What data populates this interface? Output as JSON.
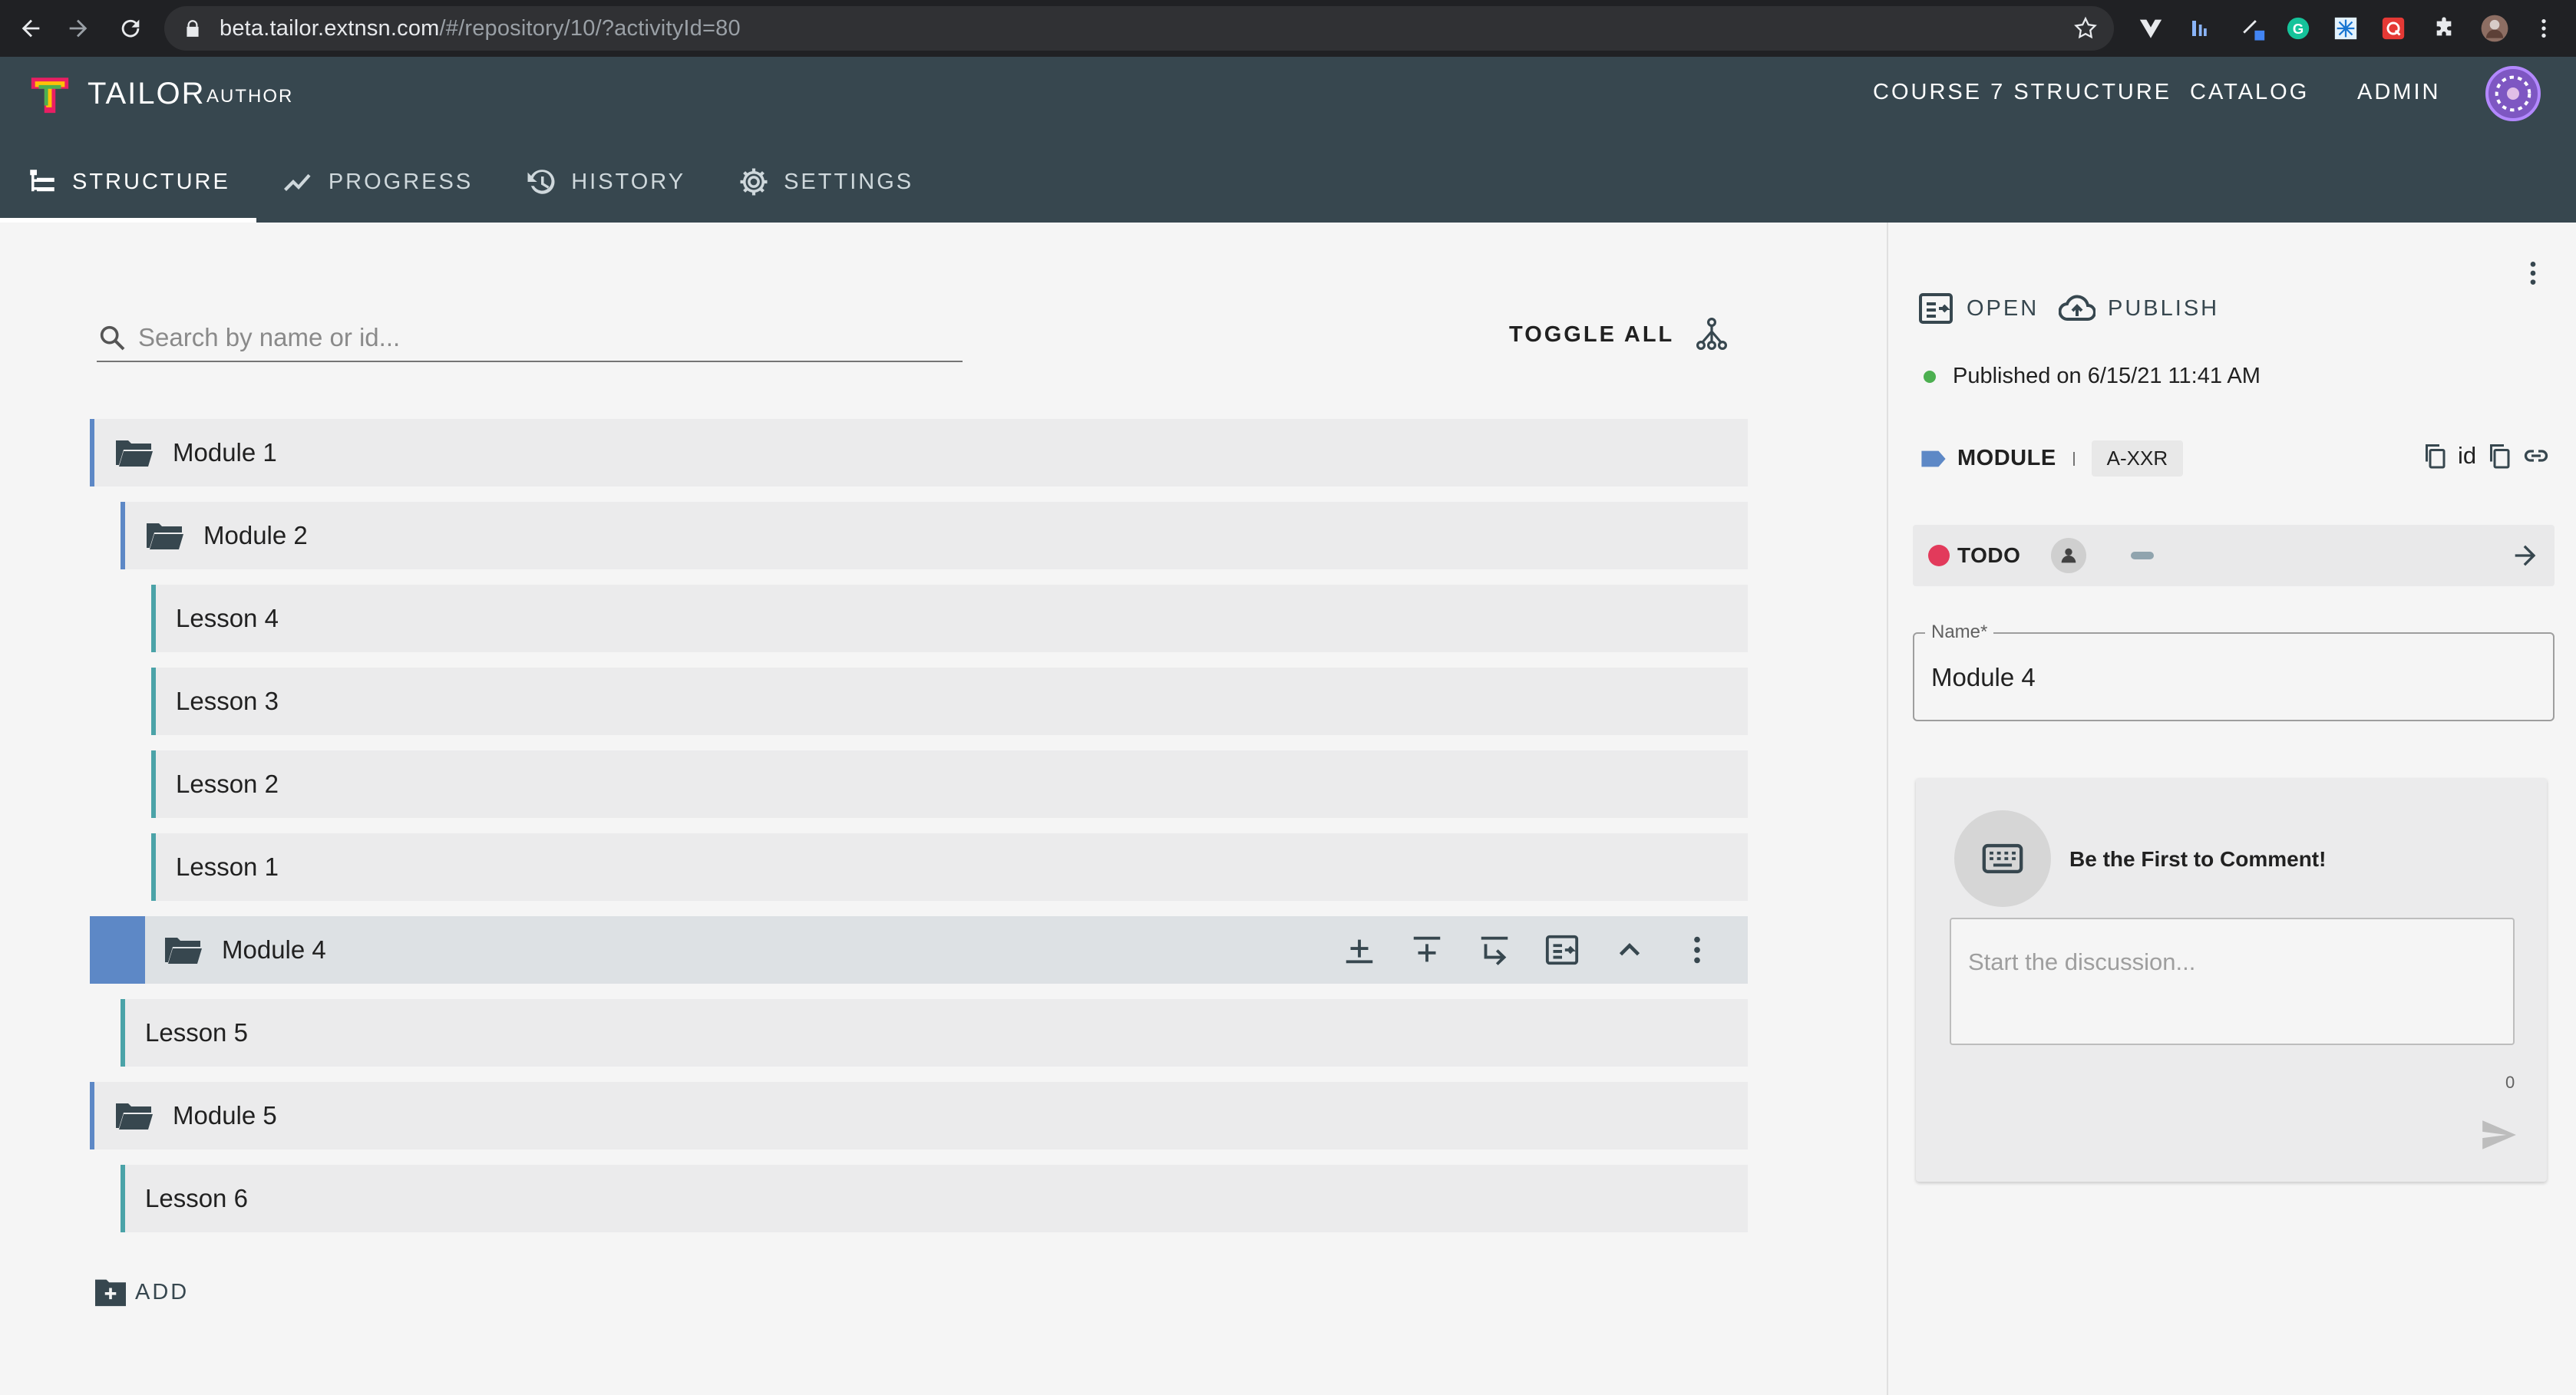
{
  "browser": {
    "url_host": "beta.tailor.extnsn.com",
    "url_path": "/#/repository/10/?activityId=80"
  },
  "app": {
    "brand": "TAILOR",
    "brand_sub": "AUTHOR",
    "top_nav": [
      "COURSE 7 STRUCTURE",
      "CATALOG",
      "ADMIN"
    ],
    "tabs": [
      {
        "label": "STRUCTURE",
        "icon": "structure-icon",
        "active": true
      },
      {
        "label": "PROGRESS",
        "icon": "trending-up-icon",
        "active": false
      },
      {
        "label": "HISTORY",
        "icon": "history-icon",
        "active": false
      },
      {
        "label": "SETTINGS",
        "icon": "gear-icon",
        "active": false
      }
    ]
  },
  "structure": {
    "search_placeholder": "Search by name or id...",
    "toggle_all": "TOGGLE ALL",
    "add_label": "ADD",
    "items": [
      {
        "label": "Module 1",
        "type": "module"
      },
      {
        "label": "Module 2",
        "type": "module"
      },
      {
        "label": "Lesson 4",
        "type": "lesson"
      },
      {
        "label": "Lesson 3",
        "type": "lesson"
      },
      {
        "label": "Lesson 2",
        "type": "lesson"
      },
      {
        "label": "Lesson 1",
        "type": "lesson"
      },
      {
        "label": "Module 4",
        "type": "module",
        "selected": true
      },
      {
        "label": "Lesson 5",
        "type": "lesson"
      },
      {
        "label": "Module 5",
        "type": "module"
      },
      {
        "label": "Lesson 6",
        "type": "lesson"
      }
    ]
  },
  "sidebar": {
    "open_label": "OPEN",
    "publish_label": "PUBLISH",
    "published_text": "Published on 6/15/21 11:41 AM",
    "type_label": "MODULE",
    "short_id": "A-XXR",
    "id_label": "id",
    "workflow_status": "TODO",
    "name_field_label": "Name*",
    "name_field_value": "Module 4",
    "comments_empty": "Be the First to Comment!",
    "comment_placeholder": "Start the discussion...",
    "comment_count": "0"
  },
  "colors": {
    "header_bg": "#37474f",
    "module_bar": "#5d88c6",
    "lesson_bar": "#4ba3a8",
    "status_todo": "#e23a5b",
    "published_dot": "#4caf50"
  }
}
